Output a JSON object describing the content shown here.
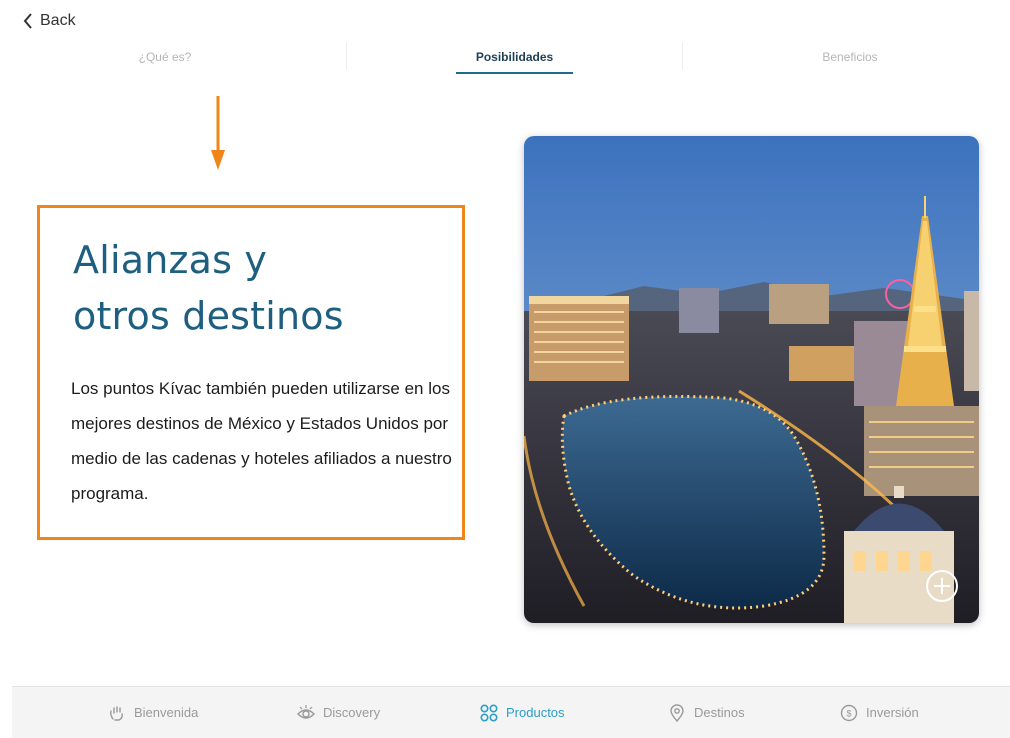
{
  "header": {
    "back_label": "Back"
  },
  "tabs": [
    {
      "label": "¿Qué es?",
      "active": false
    },
    {
      "label": "Posibilidades",
      "active": true
    },
    {
      "label": "Beneficios",
      "active": false
    }
  ],
  "content": {
    "headline_line1": "Alianzas y",
    "headline_line2": "otros destinos",
    "body": "Los puntos Kívac también pueden utilizarse en los mejores destinos de México y Estados Unidos por medio de las cadenas y hoteles afiliados a nuestro programa."
  },
  "bottom_nav": [
    {
      "label": "Bienvenida",
      "icon": "wave-hand-icon",
      "active": false
    },
    {
      "label": "Discovery",
      "icon": "eye-icon",
      "active": false
    },
    {
      "label": "Productos",
      "icon": "grid-rings-icon",
      "active": true
    },
    {
      "label": "Destinos",
      "icon": "location-pin-icon",
      "active": false
    },
    {
      "label": "Inversión",
      "icon": "dollar-coin-icon",
      "active": false
    }
  ],
  "colors": {
    "accent": "#2a9fc7",
    "headline": "#1e5f80",
    "highlight_border": "#f08519",
    "arrow": "#f08519"
  }
}
